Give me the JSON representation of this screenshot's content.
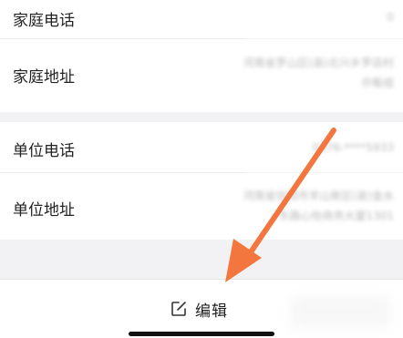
{
  "fields": [
    {
      "label": "家庭电话",
      "value_lines": [
        "0"
      ]
    },
    {
      "label": "家庭地址",
      "value_lines": [
        "河南省罗山区(县)北兴乡罗店村",
        "许畈组"
      ]
    },
    {
      "label": "单位电话",
      "value_lines": [
        "0376-****5933"
      ]
    },
    {
      "label": "单位地址",
      "value_lines": [
        "河南省信阳市羊山新区(县)金水",
        "东路心怡商务大厦1301"
      ]
    }
  ],
  "bottom_bar": {
    "edit_label": "编辑",
    "edit_icon": "edit-icon"
  },
  "annotation": {
    "arrow_color": "#f2763e"
  }
}
